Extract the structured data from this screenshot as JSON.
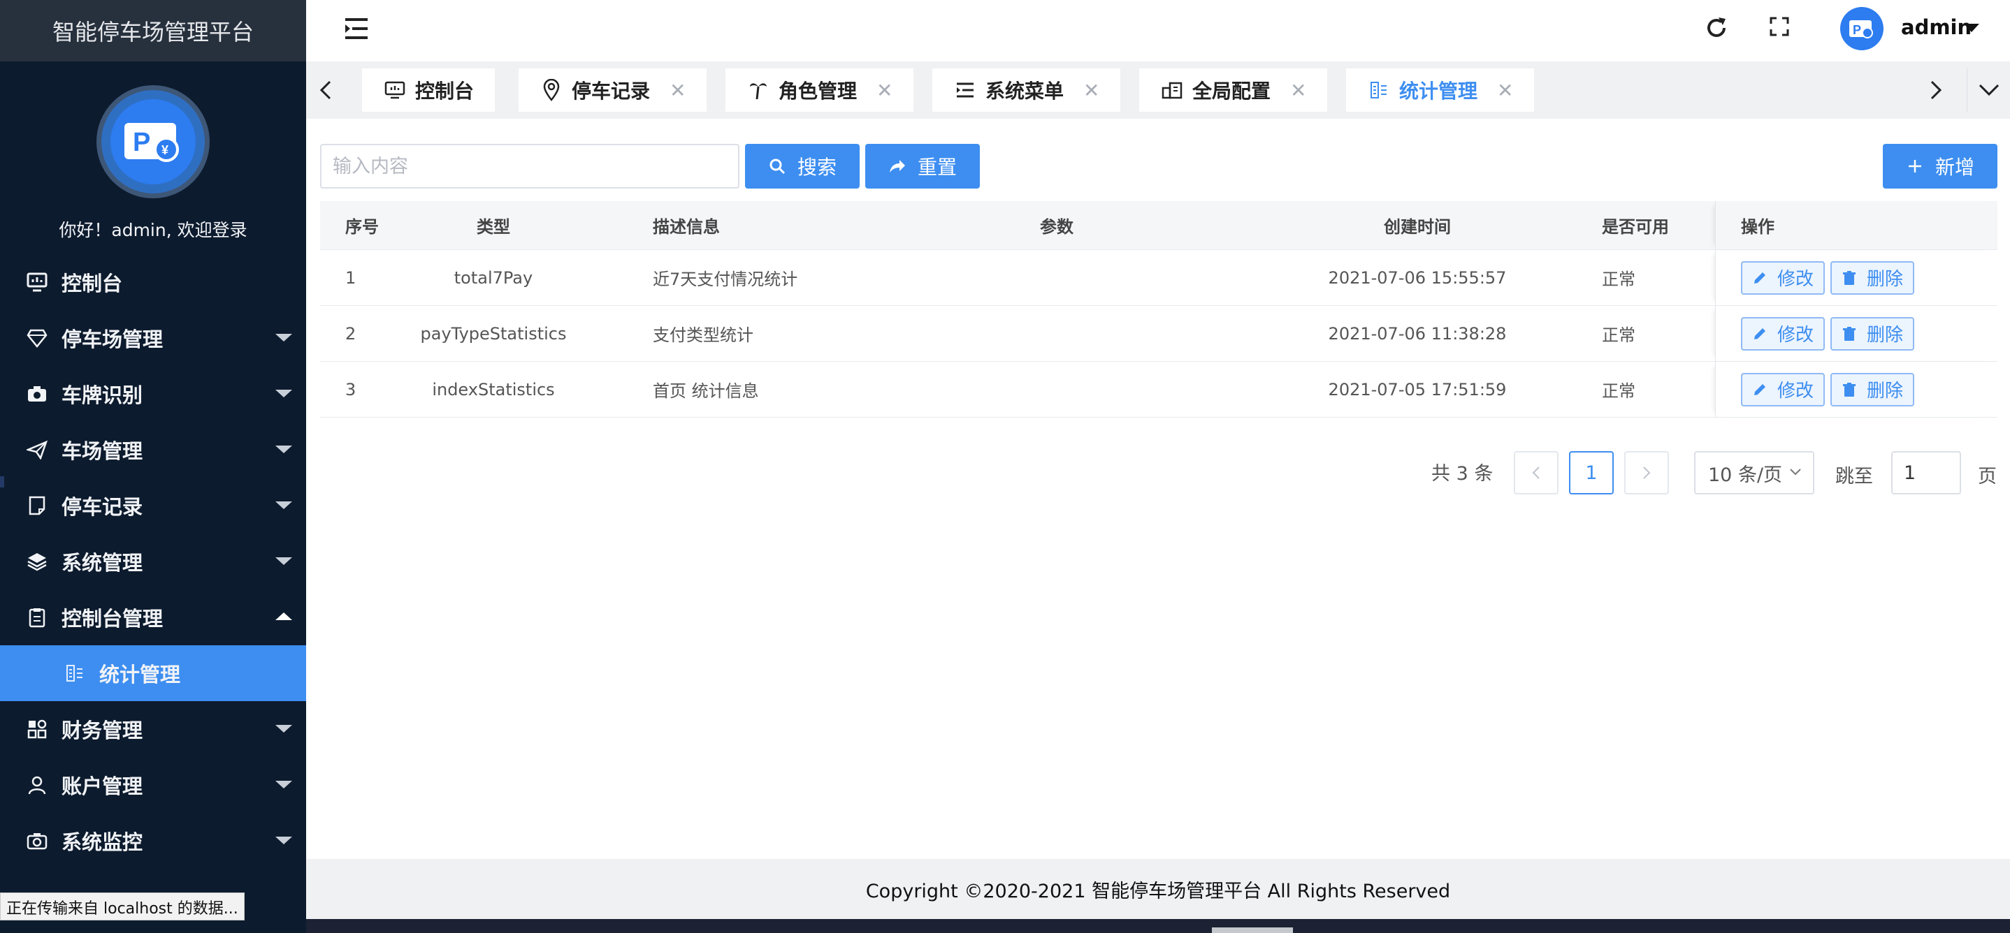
{
  "app": {
    "title": "智能停车场管理平台",
    "welcome": "你好！admin, 欢迎登录"
  },
  "colors": {
    "sidebar_bg": "#0d1b2e",
    "accent": "#3d8ef0",
    "header_bg": "#ffffff"
  },
  "sidebar": {
    "items": [
      {
        "label": "控制台",
        "icon": "monitor-icon",
        "expandable": false
      },
      {
        "label": "停车场管理",
        "icon": "diamond-icon",
        "expandable": true
      },
      {
        "label": "车牌识别",
        "icon": "camera-icon",
        "expandable": true
      },
      {
        "label": "车场管理",
        "icon": "send-icon",
        "expandable": true
      },
      {
        "label": "停车记录",
        "icon": "document-icon",
        "expandable": true
      },
      {
        "label": "系统管理",
        "icon": "layers-icon",
        "expandable": true
      },
      {
        "label": "控制台管理",
        "icon": "clipboard-icon",
        "expandable": true,
        "expanded": true
      },
      {
        "label": "统计管理",
        "icon": "stats-icon",
        "sub": true,
        "active": true
      },
      {
        "label": "财务管理",
        "icon": "apps-icon",
        "expandable": true
      },
      {
        "label": "账户管理",
        "icon": "user-icon",
        "expandable": true
      },
      {
        "label": "系统监控",
        "icon": "camera-icon",
        "expandable": true
      }
    ]
  },
  "header": {
    "username": "admin"
  },
  "tabs": [
    {
      "label": "控制台",
      "icon": "monitor-icon",
      "closable": false
    },
    {
      "label": "停车记录",
      "icon": "location-icon",
      "closable": true
    },
    {
      "label": "角色管理",
      "icon": "palm-icon",
      "closable": true
    },
    {
      "label": "系统菜单",
      "icon": "menu-icon",
      "closable": true
    },
    {
      "label": "全局配置",
      "icon": "buildings-icon",
      "closable": true
    },
    {
      "label": "统计管理",
      "icon": "stats-icon",
      "closable": true,
      "active": true
    }
  ],
  "toolbar": {
    "search_placeholder": "输入内容",
    "search_label": "搜索",
    "reset_label": "重置",
    "add_label": "新增"
  },
  "table": {
    "headers": {
      "idx": "序号",
      "type": "类型",
      "desc": "描述信息",
      "param": "参数",
      "time": "创建时间",
      "avail": "是否可用",
      "ops": "操作"
    },
    "rows": [
      {
        "idx": "1",
        "type": "total7Pay",
        "desc": "近7天支付情况统计",
        "param": "",
        "time": "2021-07-06 15:55:57",
        "avail": "正常"
      },
      {
        "idx": "2",
        "type": "payTypeStatistics",
        "desc": "支付类型统计",
        "param": "",
        "time": "2021-07-06 11:38:28",
        "avail": "正常"
      },
      {
        "idx": "3",
        "type": "indexStatistics",
        "desc": "首页 统计信息",
        "param": "",
        "time": "2021-07-05 17:51:59",
        "avail": "正常"
      }
    ],
    "edit_label": "修改",
    "delete_label": "删除"
  },
  "pagination": {
    "total": "共 3 条",
    "current": "1",
    "page_size": "10 条/页",
    "jump_label": "跳至",
    "jump_value": "1",
    "page_suffix": "页"
  },
  "footer": {
    "copyright": "Copyright ©2020-2021 智能停车场管理平台 All Rights Reserved"
  },
  "status_bar": {
    "text": "正在传输来自 localhost 的数据..."
  }
}
